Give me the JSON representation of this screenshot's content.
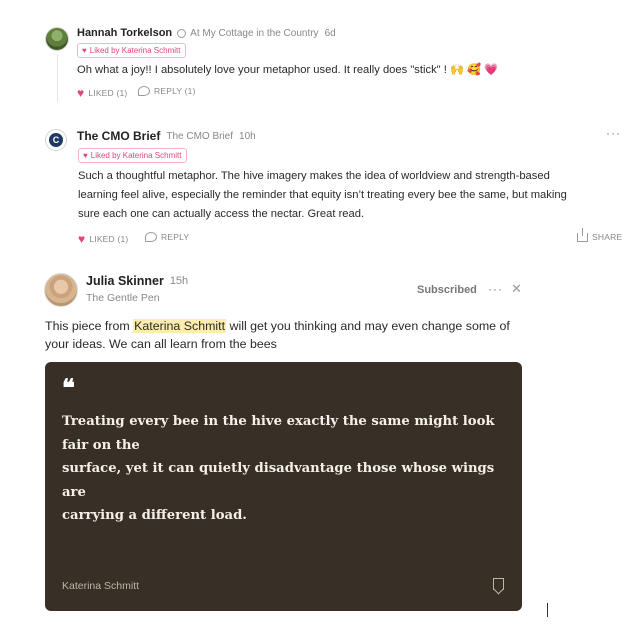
{
  "comments": [
    {
      "author": "Hannah Torkelson",
      "publication": "At My Cottage in the Country",
      "time": "6d",
      "liked_by": "Liked by Katerina Schmitt",
      "body": "Oh what a joy!! I absolutely love your metaphor used. It really does \"stick\" ! 🙌 🥰 💗",
      "like_label": "LIKED (1)",
      "reply_label": "REPLY (1)"
    },
    {
      "author": "The CMO Brief",
      "publication": "The CMO Brief",
      "time": "10h",
      "liked_by": "Liked by Katerina Schmitt",
      "body_lines": [
        "Such a thoughtful metaphor. The hive imagery makes the idea of worldview and strength-based",
        "learning feel alive, especially the reminder that equity isn’t treating every bee the same, but making",
        "sure each one can actually access the nectar. Great read."
      ],
      "like_label": "LIKED (1)",
      "reply_label": "REPLY",
      "share_label": "SHARE",
      "avatar_letter": "C"
    }
  ],
  "note": {
    "author": "Julia Skinner",
    "time": "15h",
    "publication": "The Gentle Pen",
    "subscribed_label": "Subscribed",
    "text_before": "This piece from ",
    "text_highlight": "Katerina Schmitt",
    "text_after": " will get you thinking and may even change some of",
    "text_line2": "your ideas. We can all learn from the bees",
    "quote": {
      "mark": "❝",
      "lines": [
        "Treating every bee in the hive exactly the same might look fair on the",
        "surface, yet it can quietly disadvantage those whose wings are",
        "carrying a different load."
      ],
      "author": "Katerina Schmitt"
    }
  },
  "icons": {
    "heart": "heart-icon",
    "reply": "comment-bubble-icon",
    "share": "share-icon",
    "more": "more-icon",
    "close": "close-icon",
    "bookmark": "bookmark-icon"
  },
  "colors": {
    "accent": "#e0457b",
    "quote_card_bg": "#383027",
    "highlight": "#fdecb0"
  }
}
